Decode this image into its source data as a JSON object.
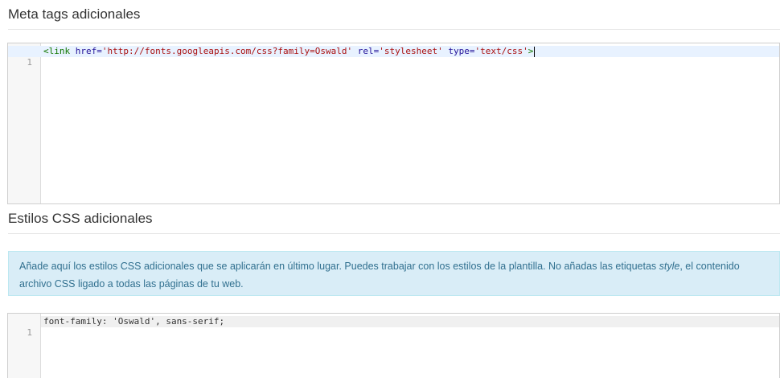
{
  "meta": {
    "title": "Meta tags adicionales",
    "editor": {
      "line_number": "1",
      "tokens": {
        "open": "<link",
        "attr1": "href=",
        "val1": "'http://fonts.googleapis.com/css?family=Oswald'",
        "attr2": "rel=",
        "val2": "'stylesheet'",
        "attr3": "type=",
        "val3": "'text/css'",
        "close": ">"
      }
    }
  },
  "css": {
    "title": "Estilos CSS adicionales",
    "info": {
      "line1_a": "Añade aquí los estilos CSS adicionales que se aplicarán en último lugar. Puedes trabajar con los estilos de la plantilla. No añadas las etiquetas ",
      "line1_em": "style",
      "line1_b": ", el contenido",
      "line2": "archivo CSS ligado a todas las páginas de tu web."
    },
    "editor": {
      "line_number": "1",
      "code": "font-family: 'Oswald', sans-serif;"
    }
  }
}
